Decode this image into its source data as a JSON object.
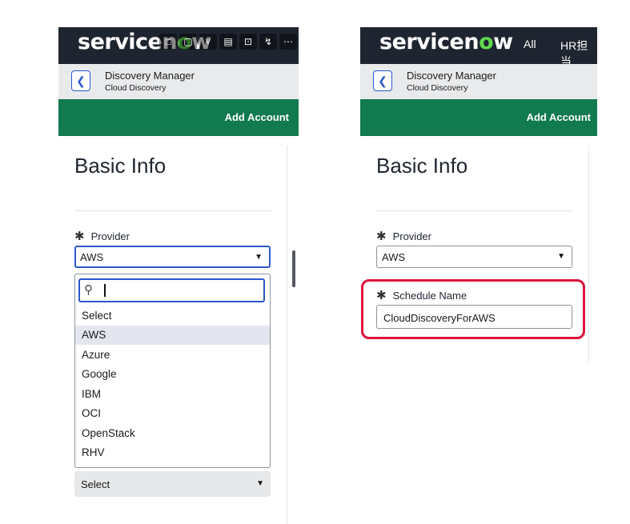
{
  "brand": {
    "logo_a": "servicen",
    "logo_o": "o",
    "logo_b": "w"
  },
  "left_panel": {
    "toolbar_icons": [
      "comment-icon",
      "screenshot-icon",
      "chevron-down-icon",
      "window-icon",
      "crop-icon",
      "download-icon",
      "more-icon"
    ],
    "breadcrumb": {
      "title": "Discovery Manager",
      "subtitle": "Cloud Discovery"
    },
    "add_account": "Add Account",
    "heading": "Basic Info",
    "provider_label": "Provider",
    "provider_value": "AWS",
    "options": [
      "Select",
      "AWS",
      "Azure",
      "Google",
      "IBM",
      "OCI",
      "OpenStack",
      "RHV"
    ],
    "highlighted_option": "AWS",
    "second_select_value": "Select"
  },
  "right_panel": {
    "nav_all": "All",
    "nav_hr": "HR担当",
    "breadcrumb": {
      "title": "Discovery Manager",
      "subtitle": "Cloud Discovery"
    },
    "add_account": "Add Account",
    "heading": "Basic Info",
    "provider_label": "Provider",
    "provider_value": "AWS",
    "schedule_label": "Schedule Name",
    "schedule_value": "CloudDiscoveryForAWS"
  },
  "colors": {
    "topbar": "#1f2530",
    "green": "#117a4f",
    "focus_blue": "#2d57c8",
    "callout_red": "#e0143c",
    "logo_green": "#62d84e"
  }
}
